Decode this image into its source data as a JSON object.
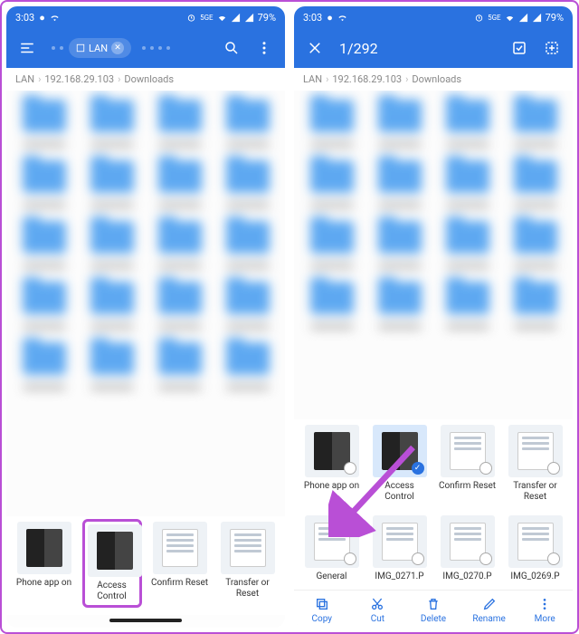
{
  "status": {
    "time": "3:03",
    "battery": "79%"
  },
  "crumbs": {
    "c1": "LAN",
    "c2": "192.168.29.103",
    "c3": "Downloads"
  },
  "left": {
    "chip": "LAN",
    "files": [
      {
        "label": "Phone app on"
      },
      {
        "label": "Access Control"
      },
      {
        "label": "Confirm Reset"
      },
      {
        "label": "Transfer or Reset"
      }
    ]
  },
  "right": {
    "count": "1/292",
    "row1": [
      {
        "label": "Phone app on"
      },
      {
        "label": "Access Control"
      },
      {
        "label": "Confirm Reset"
      },
      {
        "label": "Transfer or Reset"
      }
    ],
    "row2": [
      {
        "label": "General"
      },
      {
        "label": "IMG_0271.P"
      },
      {
        "label": "IMG_0270.P"
      },
      {
        "label": "IMG_0269.P"
      }
    ],
    "actions": {
      "copy": "Copy",
      "cut": "Cut",
      "delete": "Delete",
      "rename": "Rename",
      "more": "More"
    }
  }
}
